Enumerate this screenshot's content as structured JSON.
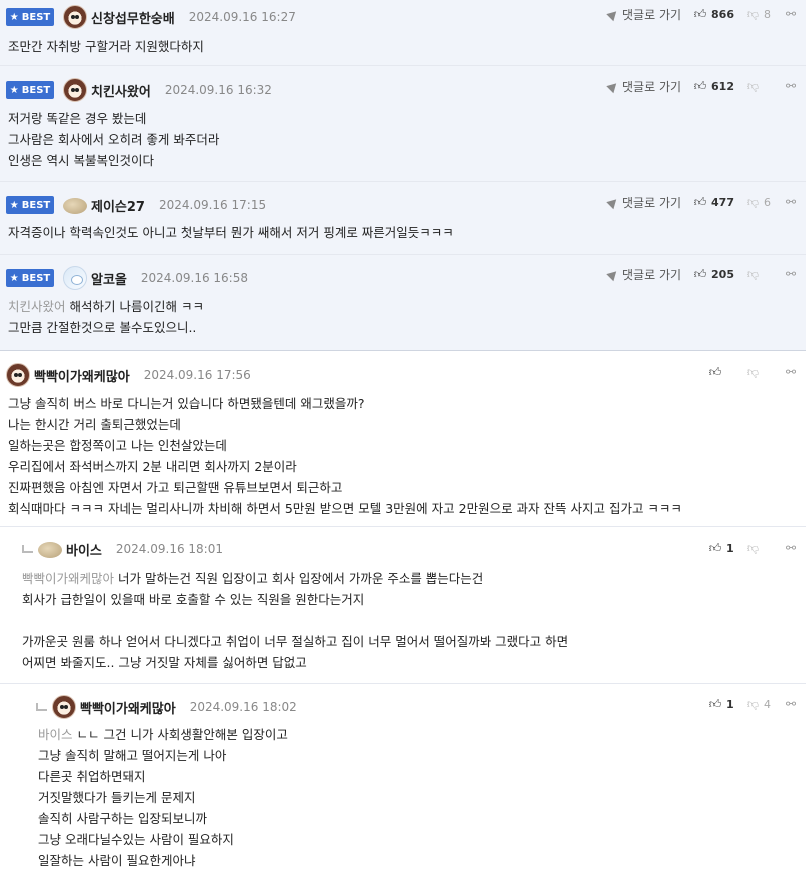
{
  "labels": {
    "best": "BEST",
    "goto": "댓글로 가기"
  },
  "comments": [
    {
      "nick": "신창섭무한숭배",
      "date": "2024.09.16 16:27",
      "likes": "866",
      "dislikes": "8",
      "lines": [
        "조만간 자취방 구할거라 지원했다하지"
      ]
    },
    {
      "nick": "치킨사왔어",
      "date": "2024.09.16 16:32",
      "likes": "612",
      "lines": [
        "저거랑 똑같은 경우 봤는데",
        "그사람은 회사에서 오히려 좋게 봐주더라",
        "인생은 역시 복불복인것이다"
      ]
    },
    {
      "nick": "제이슨27",
      "date": "2024.09.16 17:15",
      "likes": "477",
      "dislikes": "6",
      "lines": [
        "자격증이나 학력속인것도 아니고 첫날부터 뭔가 쌔해서 저거 핑계로 짜른거일듯ㅋㅋㅋ"
      ]
    },
    {
      "nick": "알코올",
      "date": "2024.09.16 16:58",
      "likes": "205",
      "mention": "치킨사왔어",
      "lines": [
        "해석하기 나름이긴해 ㅋㅋ",
        "그만큼 간절한것으로 볼수도있으니.."
      ]
    },
    {
      "nick": "빡빡이가왜케많아",
      "date": "2024.09.16 17:56",
      "lines": [
        "그냥 솔직히 버스 바로 다니는거 있습니다 하면됐을텐데 왜그랬을까?",
        "나는 한시간 거리 출퇴근했었는데",
        "일하는곳은 합정쪽이고 나는 인천살았는데",
        "우리집에서 좌석버스까지 2분 내리면 회사까지 2분이라",
        "진짜편했음 아침엔 자면서 가고 퇴근할땐 유튜브보면서 퇴근하고",
        "회식때마다 ㅋㅋㅋ 자네는 멀리사니까 차비해 하면서 5만원 받으면 모텔 3만원에 자고 2만원으로 과자 잔뜩 사지고 집가고 ㅋㅋㅋ"
      ]
    },
    {
      "nick": "바이스",
      "date": "2024.09.16 18:01",
      "likes": "1",
      "mention": "빡빡이가왜케많아",
      "lines": [
        "너가 말하는건 직원 입장이고 회사 입장에서 가까운 주소를 뽑는다는건",
        "회사가 급한일이 있을때 바로 호출할 수 있는 직원을 원한다는거지",
        "",
        "가까운곳 원룸 하나 얻어서 다니겠다고 취업이 너무 절실하고 집이 너무 멀어서 떨어질까봐 그랬다고 하면",
        "어찌면 봐줄지도.. 그냥 거짓말 자체를 싫어하면 답없고"
      ]
    },
    {
      "nick": "빡빡이가왜케많아",
      "date": "2024.09.16 18:02",
      "likes": "1",
      "dislikes": "4",
      "mention": "바이스",
      "lines": [
        "ㄴㄴ 그건 니가 사회생활안해본 입장이고",
        "그냥 솔직히 말해고 떨어지는게 나아",
        "다른곳 취업하면돼지",
        "거짓말했다가 들키는게 문제지",
        "솔직히 사람구하는 입장되보니까",
        "그냥 오래다닐수있는 사람이 필요하지",
        "일잘하는 사람이 필요한게아냐"
      ]
    }
  ]
}
